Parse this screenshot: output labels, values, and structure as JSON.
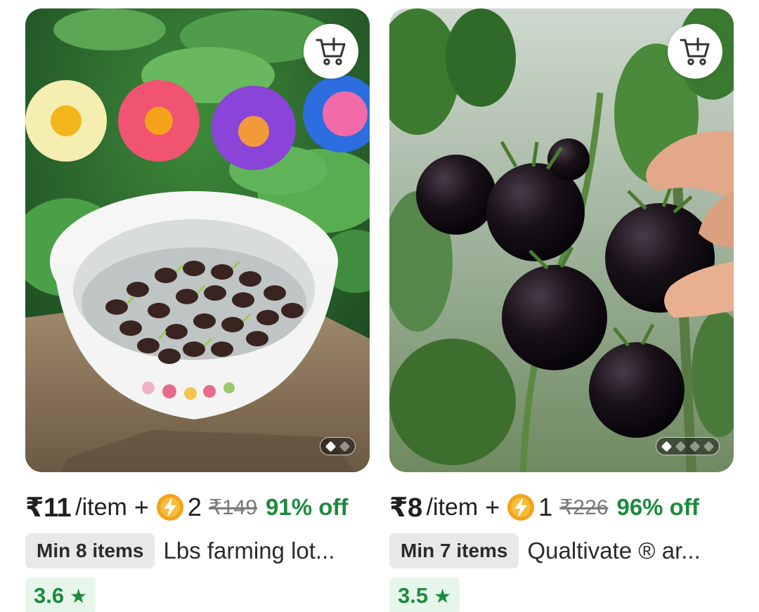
{
  "colors": {
    "discount_green": "#1e8a3e",
    "rating_bg": "#e6f6ea",
    "badge_bg": "#e8e8e8",
    "mrp_gray": "#7a7a7a"
  },
  "products": [
    {
      "price": "₹11",
      "unit": "/item",
      "plus": "+",
      "coin_icon": "lightning-coin-icon",
      "coins": "2",
      "mrp": "₹149",
      "discount": "91% off",
      "min_items": "Min 8 items",
      "title": "Lbs farming lot...",
      "rating": "3.6",
      "star": "★",
      "image_icon": "lotus-seeds-bowl-image",
      "cart_icon": "add-to-cart-icon",
      "image_count": 2,
      "active_image": 1
    },
    {
      "price": "₹8",
      "unit": "/item",
      "plus": "+",
      "coin_icon": "lightning-coin-icon",
      "coins": "1",
      "mrp": "₹226",
      "discount": "96% off",
      "min_items": "Min 7 items",
      "title": "Qualtivate ® ar...",
      "rating": "3.5",
      "star": "★",
      "image_icon": "black-tomatoes-image",
      "cart_icon": "add-to-cart-icon",
      "image_count": 4,
      "active_image": 1
    }
  ]
}
